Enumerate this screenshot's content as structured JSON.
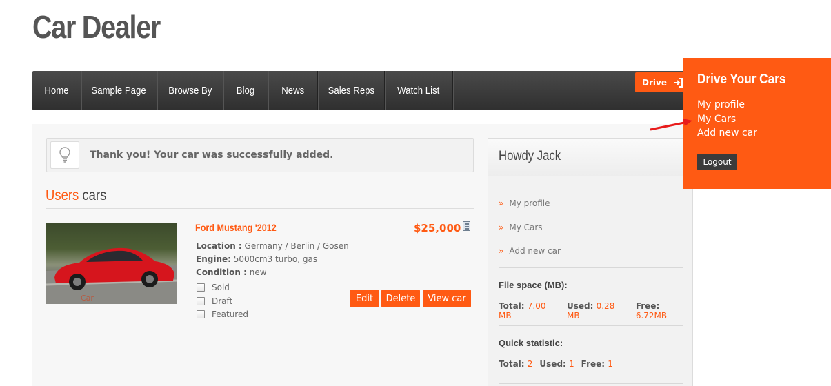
{
  "site": {
    "title": "Car Dealer"
  },
  "nav": {
    "items": [
      {
        "label": "Home"
      },
      {
        "label": "Sample Page"
      },
      {
        "label": "Browse By"
      },
      {
        "label": "Blog"
      },
      {
        "label": "News"
      },
      {
        "label": "Sales Reps"
      },
      {
        "label": "Watch List"
      }
    ],
    "drive_label": "Drive"
  },
  "notice": {
    "message": "Thank you! Your car was successfully added."
  },
  "section": {
    "title_accent": "Users",
    "title_rest": "cars"
  },
  "listing": {
    "name": "Ford Mustang '2012",
    "price": "$25,000",
    "location_label": "Location :",
    "location": "Germany / Berlin / Gosen",
    "engine_label": "Engine:",
    "engine": "5000cm3 turbo, gas",
    "condition_label": "Condition :",
    "condition": "new",
    "options": [
      {
        "label": "Sold",
        "checked": false
      },
      {
        "label": "Draft",
        "checked": false
      },
      {
        "label": "Featured",
        "checked": false
      }
    ],
    "actions": {
      "edit": "Edit",
      "delete": "Delete",
      "view": "View car"
    }
  },
  "widget": {
    "title": "Howdy Jack",
    "links": [
      {
        "label": "My profile"
      },
      {
        "label": "My Cars"
      },
      {
        "label": "Add new car"
      }
    ],
    "file_space": {
      "heading": "File space (MB):",
      "total_label": "Total:",
      "total": "7.00 MB",
      "used_label": "Used:",
      "used": "0.28 MB",
      "free_label": "Free:",
      "free": "6.72MB"
    },
    "quick_stat": {
      "heading": "Quick statistic:",
      "total_label": "Total:",
      "total": "2",
      "used_label": "Used:",
      "used": "1",
      "free_label": "Free:",
      "free": "1"
    }
  },
  "popup": {
    "title": "Drive Your Cars",
    "links": [
      {
        "label": "My profile"
      },
      {
        "label": "My Cars"
      },
      {
        "label": "Add new car"
      }
    ],
    "logout": "Logout"
  },
  "colors": {
    "accent": "#ff5a13",
    "nav_bg": "#3a3a3a",
    "panel_bg": "#f7f7f7"
  }
}
